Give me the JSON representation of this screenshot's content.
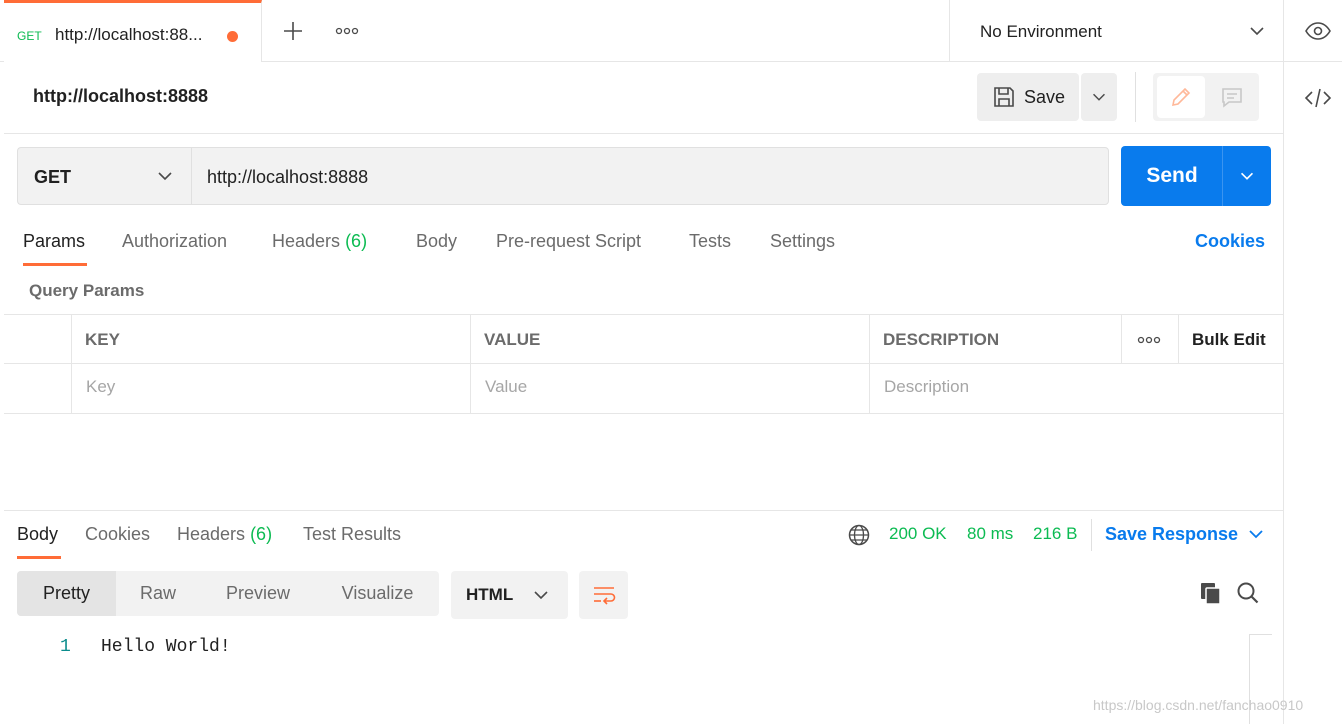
{
  "tab": {
    "method": "GET",
    "title": "http://localhost:88..."
  },
  "environment": {
    "label": "No Environment"
  },
  "request": {
    "name": "http://localhost:8888",
    "save_label": "Save",
    "method": "GET",
    "url": "http://localhost:8888",
    "send_label": "Send"
  },
  "request_tabs": {
    "params": "Params",
    "authorization": "Authorization",
    "headers": "Headers",
    "headers_count": "(6)",
    "body": "Body",
    "prerequest": "Pre-request Script",
    "tests": "Tests",
    "settings": "Settings",
    "cookies": "Cookies"
  },
  "query_params": {
    "title": "Query Params",
    "columns": {
      "key": "KEY",
      "value": "VALUE",
      "description": "DESCRIPTION"
    },
    "bulk_edit": "Bulk Edit",
    "placeholders": {
      "key": "Key",
      "value": "Value",
      "description": "Description"
    }
  },
  "response": {
    "tabs": {
      "body": "Body",
      "cookies": "Cookies",
      "headers": "Headers",
      "headers_count": "(6)",
      "test_results": "Test Results"
    },
    "status": "200 OK",
    "time": "80 ms",
    "size": "216 B",
    "save_response": "Save Response",
    "formats": {
      "pretty": "Pretty",
      "raw": "Raw",
      "preview": "Preview",
      "visualize": "Visualize"
    },
    "language": "HTML",
    "lines": [
      {
        "number": "1",
        "text": "Hello World!"
      }
    ]
  },
  "watermark": "https://blog.csdn.net/fanchao0910",
  "colors": {
    "accent_orange": "#ff6c37",
    "primary_blue": "#097bed",
    "success_green": "#0cbb52"
  },
  "icons": [
    "plus-icon",
    "more-icon",
    "chevron-down-icon",
    "eye-icon",
    "code-icon",
    "save-icon",
    "pencil-icon",
    "comment-icon",
    "globe-icon",
    "wrap-icon",
    "copy-icon",
    "search-icon"
  ]
}
